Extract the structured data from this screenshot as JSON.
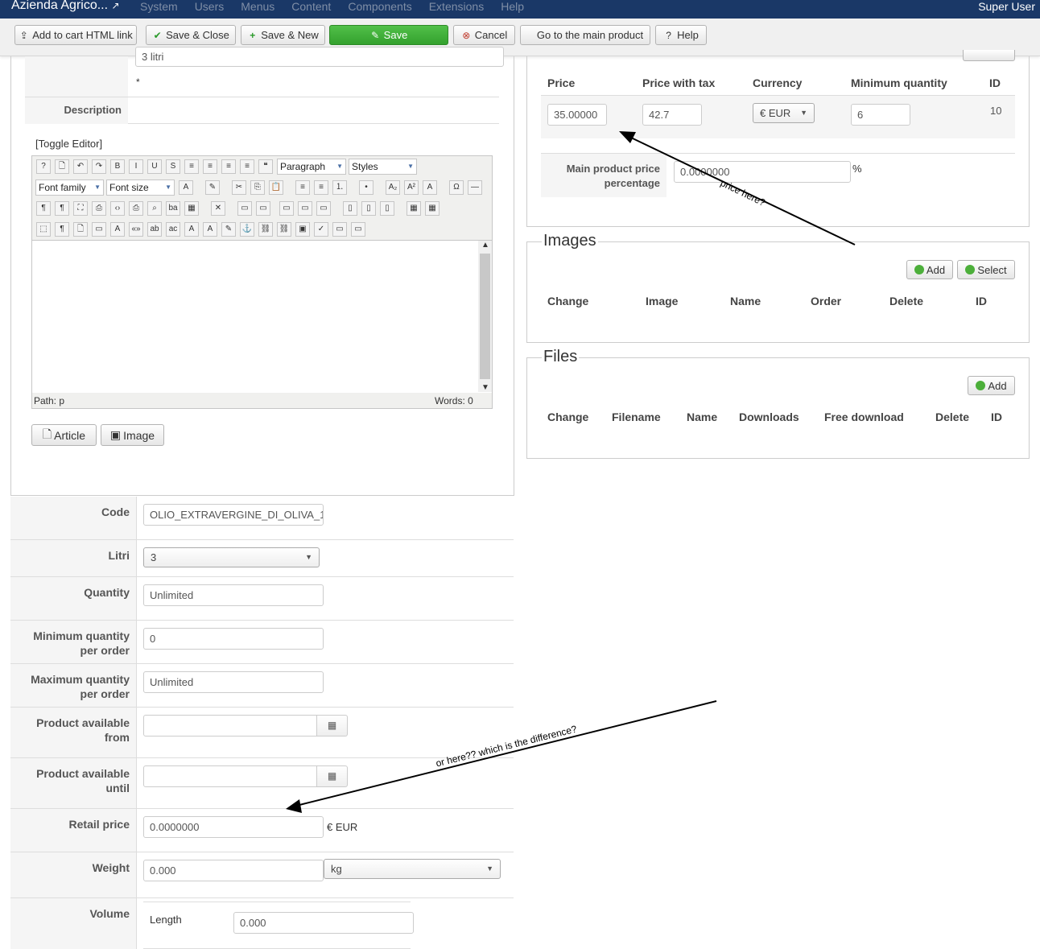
{
  "topnav": {
    "brand": "Azienda Agrico...",
    "menu": [
      "System",
      "Users",
      "Menus",
      "Content",
      "Components",
      "Extensions",
      "Help"
    ],
    "user": "Super User"
  },
  "toolbar": {
    "add_cart": "Add to cart HTML link",
    "save_close": "Save & Close",
    "save_new": "Save & New",
    "save": "Save",
    "cancel": "Cancel",
    "main_product": "Go to the main product",
    "help": "Help"
  },
  "left": {
    "name_value": "3 litri",
    "required_star": "*",
    "description_label": "Description",
    "toggle_editor": "[Toggle Editor]",
    "editor": {
      "format": "Paragraph",
      "styles": "Styles",
      "font_family": "Font family",
      "font_size": "Font size",
      "path_label": "Path:",
      "path_value": "p",
      "words": "Words: 0"
    },
    "article_btn": "Article",
    "image_btn": "Image"
  },
  "fields": {
    "code_label": "Code",
    "code_value": "OLIO_EXTRAVERGINE_DI_OLIVA_1",
    "litri_label": "Litri",
    "litri_value": "3",
    "quantity_label": "Quantity",
    "quantity_value": "Unlimited",
    "minq_label": "Minimum quantity per order",
    "minq_value": "0",
    "maxq_label": "Maximum quantity per order",
    "maxq_value": "Unlimited",
    "from_label": "Product available from",
    "until_label": "Product available until",
    "retail_label": "Retail price",
    "retail_value": "0.0000000",
    "retail_unit": "€ EUR",
    "weight_label": "Weight",
    "weight_value": "0.000",
    "weight_unit": "kg",
    "volume_label": "Volume",
    "length_label": "Length",
    "length_value": "0.000"
  },
  "prices": {
    "headers": [
      "Price",
      "Price with tax",
      "Currency",
      "Minimum quantity",
      "ID"
    ],
    "price": "35.00000",
    "price_tax": "42.7",
    "currency": "€ EUR",
    "min_qty": "6",
    "id": "10",
    "main_pct_label": "Main product price percentage",
    "main_pct_value": "0.0000000",
    "pct": "%"
  },
  "images": {
    "title": "Images",
    "add": "Add",
    "select": "Select",
    "headers": [
      "Change",
      "Image",
      "Name",
      "Order",
      "Delete",
      "ID"
    ]
  },
  "files": {
    "title": "Files",
    "add": "Add",
    "headers": [
      "Change",
      "Filename",
      "Name",
      "Downloads",
      "Free download",
      "Delete",
      "ID"
    ]
  },
  "annotations": {
    "a1": "price here?",
    "a2": "or here?? which is the difference?"
  }
}
